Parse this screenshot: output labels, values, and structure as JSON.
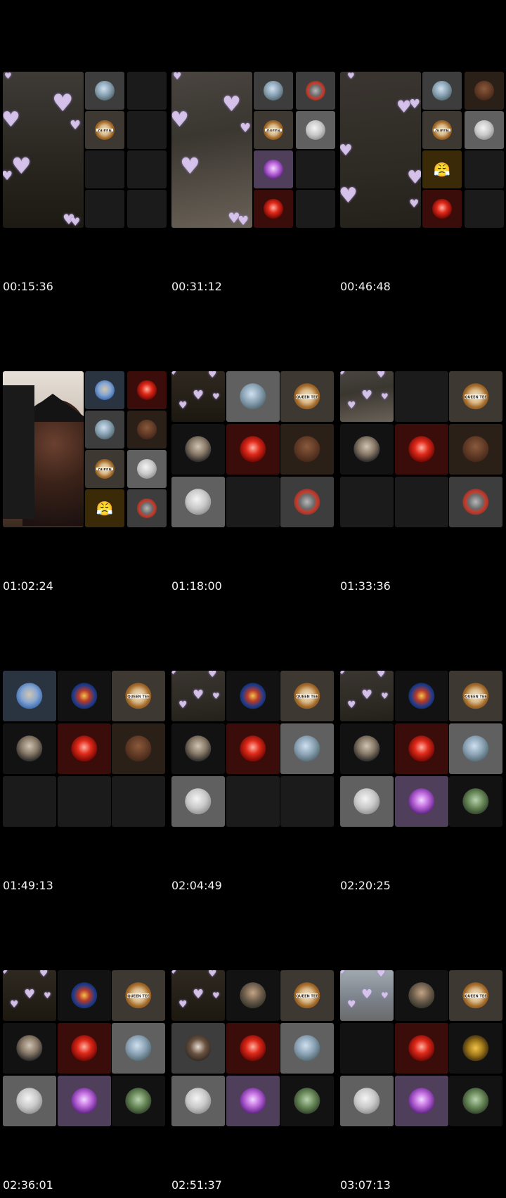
{
  "timestamps": [
    "00:15:36",
    "00:31:12",
    "00:46:48",
    "01:02:24",
    "01:18:00",
    "01:33:36",
    "01:49:13",
    "02:04:49",
    "02:20:25",
    "02:36:01",
    "02:51:37",
    "03:07:13"
  ],
  "icons": {
    "heart": "♥",
    "logo_text": "QUEEN TEE",
    "emoji": "😤"
  },
  "colors": {
    "background": "#000000",
    "tile_dark": "#1b1b1b",
    "tile_brown": "#3a3530",
    "tile_red": "#3a1010",
    "tile_purple": "#4a3a55",
    "heart": "#e1cdf0",
    "timestamp": "#f2f2f2"
  }
}
